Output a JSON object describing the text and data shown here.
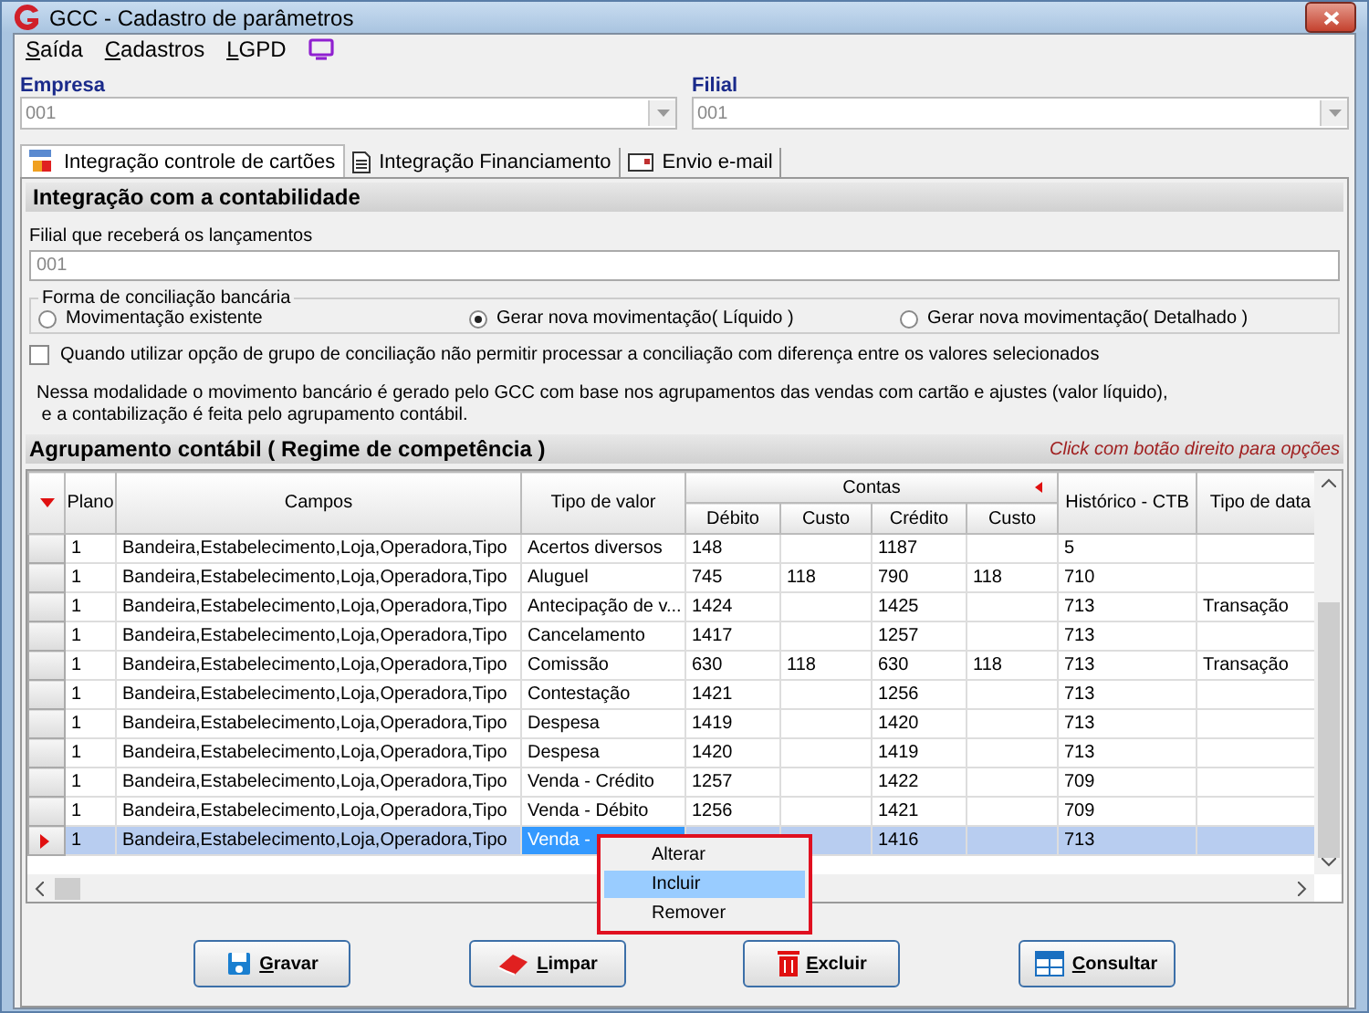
{
  "window": {
    "title": "GCC - Cadastro de parâmetros"
  },
  "menu": [
    "Saída",
    "Cadastros",
    "LGPD"
  ],
  "empresa": {
    "label": "Empresa",
    "value": "001"
  },
  "filial": {
    "label": "Filial",
    "value": "001"
  },
  "tabs": [
    {
      "label": "Integração controle de cartões",
      "selected": true
    },
    {
      "label": "Integração Financiamento",
      "selected": false
    },
    {
      "label": "Envio e-mail",
      "selected": false
    }
  ],
  "section_title": "Integração com a contabilidade",
  "filial_lancamentos": {
    "label": "Filial que receberá os lançamentos",
    "value": "001"
  },
  "conciliacao": {
    "title": "Forma de conciliação bancária",
    "options": [
      {
        "label": "Movimentação existente",
        "selected": false
      },
      {
        "label": "Gerar nova movimentação( Líquido )",
        "selected": true
      },
      {
        "label": "Gerar nova movimentação( Detalhado )",
        "selected": false
      }
    ]
  },
  "checkbox": {
    "label": "Quando utilizar opção de grupo de conciliação não permitir processar a conciliação com diferença entre os valores selecionados",
    "checked": false
  },
  "info_lines": [
    "Nessa modalidade o movimento bancário é gerado pelo GCC com base nos agrupamentos das vendas com cartão e ajustes (valor líquido),",
    " e a contabilização é feita pelo agrupamento contábil."
  ],
  "grid": {
    "title": "Agrupamento contábil ( Regime de competência )",
    "hint": "Click com botão direito para opções",
    "columns": {
      "plano": "Plano",
      "campos": "Campos",
      "tipo": "Tipo de valor",
      "contas": "Contas",
      "debito": "Débito",
      "custo_debito": "Custo",
      "credito": "Crédito",
      "custo_credito": "Custo",
      "historico": "Histórico - CTB",
      "tipo_data": "Tipo de data"
    },
    "rows": [
      {
        "plano": "1",
        "campos": "Bandeira,Estabelecimento,Loja,Operadora,Tipo",
        "tipo": "Acertos diversos",
        "debito": "148",
        "credito": "1187",
        "historico": "5",
        "selected": false
      },
      {
        "plano": "1",
        "campos": "Bandeira,Estabelecimento,Loja,Operadora,Tipo",
        "tipo": "Aluguel",
        "debito": "745",
        "custo_debito": "118",
        "credito": "790",
        "custo_credito": "118",
        "historico": "710",
        "selected": false
      },
      {
        "plano": "1",
        "campos": "Bandeira,Estabelecimento,Loja,Operadora,Tipo",
        "tipo": "Antecipação de v...",
        "debito": "1424",
        "credito": "1425",
        "historico": "713",
        "tipo_data": "Transação",
        "selected": false
      },
      {
        "plano": "1",
        "campos": "Bandeira,Estabelecimento,Loja,Operadora,Tipo",
        "tipo": "Cancelamento",
        "debito": "1417",
        "credito": "1257",
        "historico": "713",
        "selected": false
      },
      {
        "plano": "1",
        "campos": "Bandeira,Estabelecimento,Loja,Operadora,Tipo",
        "tipo": "Comissão",
        "debito": "630",
        "custo_debito": "118",
        "credito": "630",
        "custo_credito": "118",
        "historico": "713",
        "tipo_data": "Transação",
        "selected": false
      },
      {
        "plano": "1",
        "campos": "Bandeira,Estabelecimento,Loja,Operadora,Tipo",
        "tipo": "Contestação",
        "debito": "1421",
        "credito": "1256",
        "historico": "713",
        "selected": false
      },
      {
        "plano": "1",
        "campos": "Bandeira,Estabelecimento,Loja,Operadora,Tipo",
        "tipo": "Despesa",
        "debito": "1419",
        "credito": "1420",
        "historico": "713",
        "selected": false
      },
      {
        "plano": "1",
        "campos": "Bandeira,Estabelecimento,Loja,Operadora,Tipo",
        "tipo": "Despesa",
        "debito": "1420",
        "credito": "1419",
        "historico": "713",
        "selected": false
      },
      {
        "plano": "1",
        "campos": "Bandeira,Estabelecimento,Loja,Operadora,Tipo",
        "tipo": "Venda - Crédito",
        "debito": "1257",
        "credito": "1422",
        "historico": "709",
        "selected": false
      },
      {
        "plano": "1",
        "campos": "Bandeira,Estabelecimento,Loja,Operadora,Tipo",
        "tipo": "Venda - Débito",
        "debito": "1256",
        "credito": "1421",
        "historico": "709",
        "selected": false
      },
      {
        "plano": "1",
        "campos": "Bandeira,Estabelecimento,Loja,Operadora,Tipo",
        "tipo": "Venda - ",
        "credito": "1416",
        "historico": "713",
        "selected": true
      }
    ]
  },
  "context_menu": [
    {
      "label": "Alterar",
      "selected": false
    },
    {
      "label": "Incluir",
      "selected": true
    },
    {
      "label": "Remover",
      "selected": false
    }
  ],
  "buttons": [
    {
      "label": "Gravar",
      "kind": "save"
    },
    {
      "label": "Limpar",
      "kind": "clear"
    },
    {
      "label": "Excluir",
      "kind": "delete"
    },
    {
      "label": "Consultar",
      "kind": "query"
    }
  ]
}
